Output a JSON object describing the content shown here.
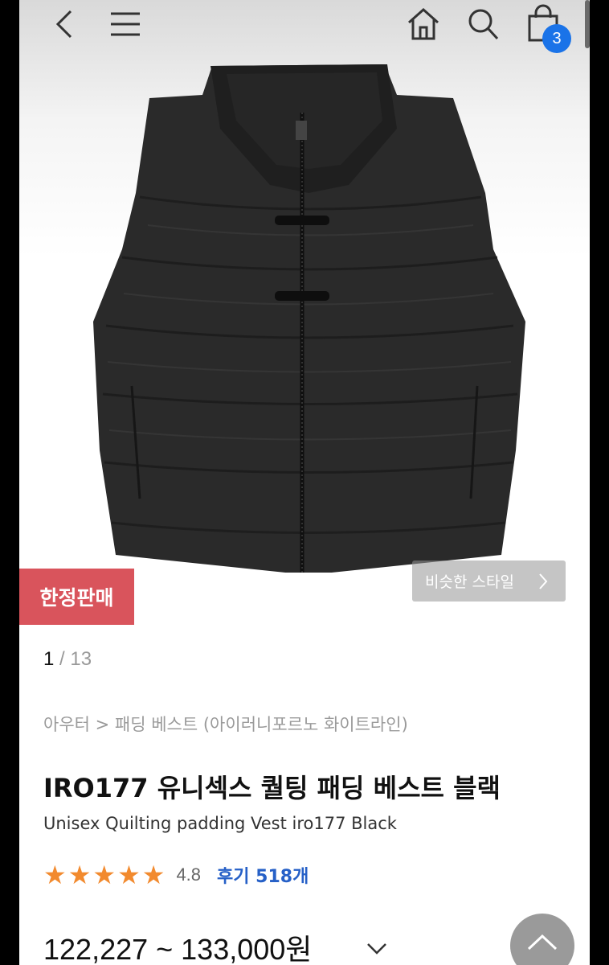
{
  "header": {
    "back_icon": "chevron-left-icon",
    "menu_icon": "hamburger-menu-icon",
    "home_icon": "home-icon",
    "search_icon": "search-icon",
    "cart_icon": "shopping-bag-icon",
    "cart_count": "3"
  },
  "gallery": {
    "limited_label": "한정판매",
    "similar_style_label": "비슷한 스타일",
    "current_page": "1",
    "separator": "/",
    "total_pages": "13"
  },
  "product": {
    "breadcrumb": "아우터 > 패딩 베스트 (아이러니포르노 화이트라인)",
    "title_ko": "IRO177 유니섹스 퀄팅 패딩 베스트 블랙",
    "title_en": "Unisex Quilting padding Vest iro177 Black",
    "rating": "4.8",
    "stars": 5,
    "reviews_label": "후기 518개",
    "price_range": "122,227 ~ 133,000원"
  },
  "colors": {
    "accent_badge": "#d9545c",
    "cart_badge": "#1a73e8",
    "star": "#f28a2e",
    "review_link": "#2660c7"
  }
}
